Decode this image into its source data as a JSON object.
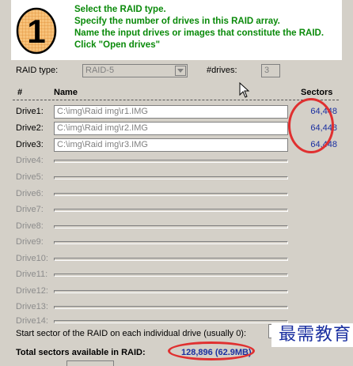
{
  "step": {
    "number": "1"
  },
  "instructions": [
    "Select the RAID type.",
    "Specify the number of drives in this RAID array.",
    "Name the input drives or images that constitute the RAID.",
    "Click \"Open drives\""
  ],
  "raid_type": {
    "label": "RAID type:",
    "value": "RAID-5"
  },
  "drives_count": {
    "label": "#drives:",
    "value": "3"
  },
  "columns": {
    "num": "#",
    "name": "Name",
    "sectors": "Sectors"
  },
  "drives": [
    {
      "label": "Drive1:",
      "path": "C:\\img\\Raid img\\r1.IMG",
      "sectors": "64,448"
    },
    {
      "label": "Drive2:",
      "path": "C:\\img\\Raid img\\r2.IMG",
      "sectors": "64,448"
    },
    {
      "label": "Drive3:",
      "path": "C:\\img\\Raid img\\r3.IMG",
      "sectors": "64,448"
    },
    {
      "label": "Drive4:"
    },
    {
      "label": "Drive5:"
    },
    {
      "label": "Drive6:"
    },
    {
      "label": "Drive7:"
    },
    {
      "label": "Drive8:"
    },
    {
      "label": "Drive9:"
    },
    {
      "label": "Drive10:"
    },
    {
      "label": "Drive11:"
    },
    {
      "label": "Drive12:"
    },
    {
      "label": "Drive13:"
    },
    {
      "label": "Drive14:"
    }
  ],
  "start_sector": {
    "label": "Start sector of the RAID on each individual drive (usually 0):"
  },
  "total": {
    "label": "Total sectors available in RAID:",
    "value": "128,896 (62.9MB)"
  },
  "watermark": {
    "text": "最需教育"
  },
  "colors": {
    "instruction_green": "#0a8a0a",
    "value_blue": "#1a2fa0",
    "annotation_red": "#e03030",
    "badge_orange": "#f0a040"
  }
}
